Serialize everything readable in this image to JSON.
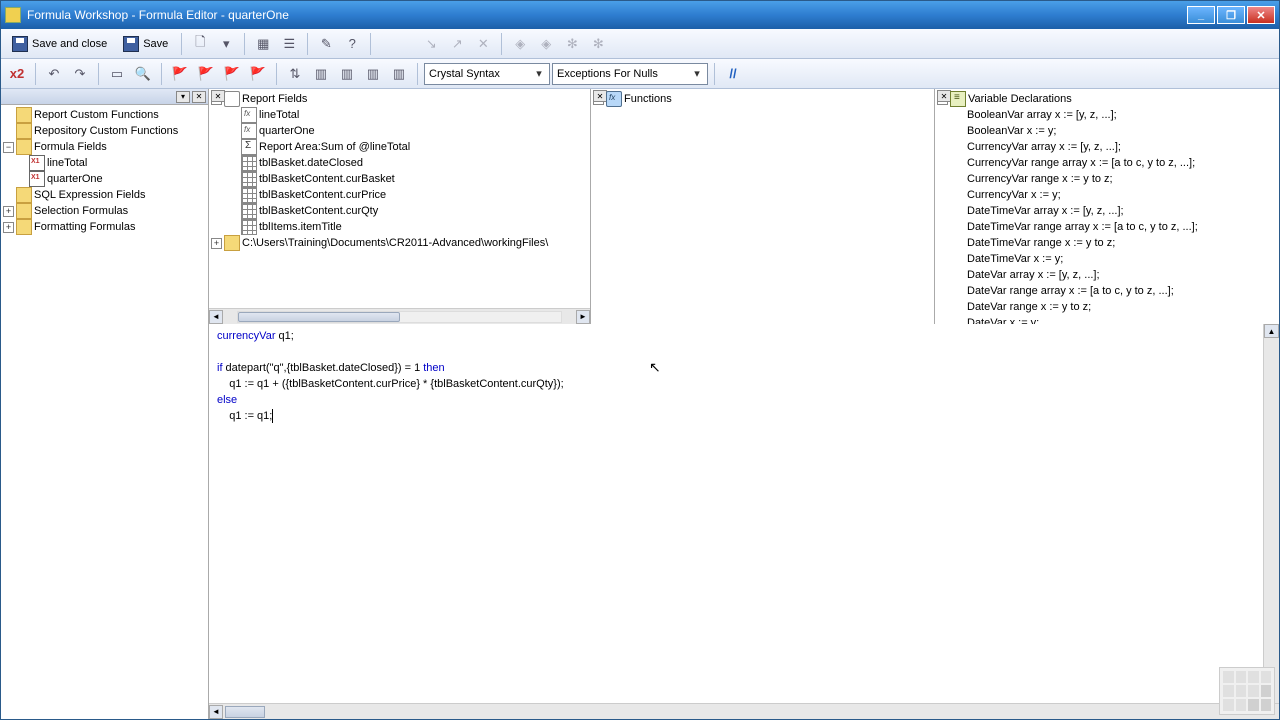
{
  "title": "Formula Workshop - Formula Editor - quarterOne",
  "toolbar": {
    "save_and_close": "Save and close",
    "save": "Save"
  },
  "combo_syntax": "Crystal Syntax",
  "combo_nulls": "Exceptions For Nulls",
  "left_tree": {
    "custom_funcs": "Report Custom Functions",
    "repo_funcs": "Repository Custom Functions",
    "formula_fields": "Formula Fields",
    "lineTotal": "lineTotal",
    "quarterOne": "quarterOne",
    "sql_expr": "SQL Expression Fields",
    "selection": "Selection Formulas",
    "formatting": "Formatting Formulas"
  },
  "fields_panel": {
    "root": "Report Fields",
    "items": {
      "lineTotal": "lineTotal",
      "quarterOne": "quarterOne",
      "sum": "Report Area:Sum of @lineTotal",
      "dateClosed": "tblBasket.dateClosed",
      "curBasket": "tblBasketContent.curBasket",
      "curPrice": "tblBasketContent.curPrice",
      "curQty": "tblBasketContent.curQty",
      "itemTitle": "tblItems.itemTitle"
    },
    "path": "C:\\Users\\Training\\Documents\\CR2011-Advanced\\workingFiles\\"
  },
  "functions_panel": {
    "root": "Functions"
  },
  "vars_panel": {
    "root": "Variable Declarations",
    "items": [
      "BooleanVar array x := [y, z, ...];",
      "BooleanVar x := y;",
      "CurrencyVar array x := [y, z, ...];",
      "CurrencyVar range array x := [a to c, y to z, ...];",
      "CurrencyVar range x := y to z;",
      "CurrencyVar x := y;",
      "DateTimeVar array x := [y, z, ...];",
      "DateTimeVar range array x := [a to c, y to z, ...];",
      "DateTimeVar range x := y to z;",
      "DateTimeVar x := y;",
      "DateVar array x := [y, z, ...];",
      "DateVar range array x := [a to c, y to z, ...];",
      "DateVar range x := y to z;",
      "DateVar x := y;"
    ]
  },
  "code": {
    "l1a": "currencyVar",
    "l1b": " q1;",
    "l3a": "if",
    "l3b": " datepart(\"q\",{tblBasket.dateClosed}) = 1 ",
    "l3c": "then",
    "l4": "    q1 := q1 + ({tblBasketContent.curPrice} * {tblBasketContent.curQty});",
    "l5": "else",
    "l6": "    q1 := q1;"
  }
}
